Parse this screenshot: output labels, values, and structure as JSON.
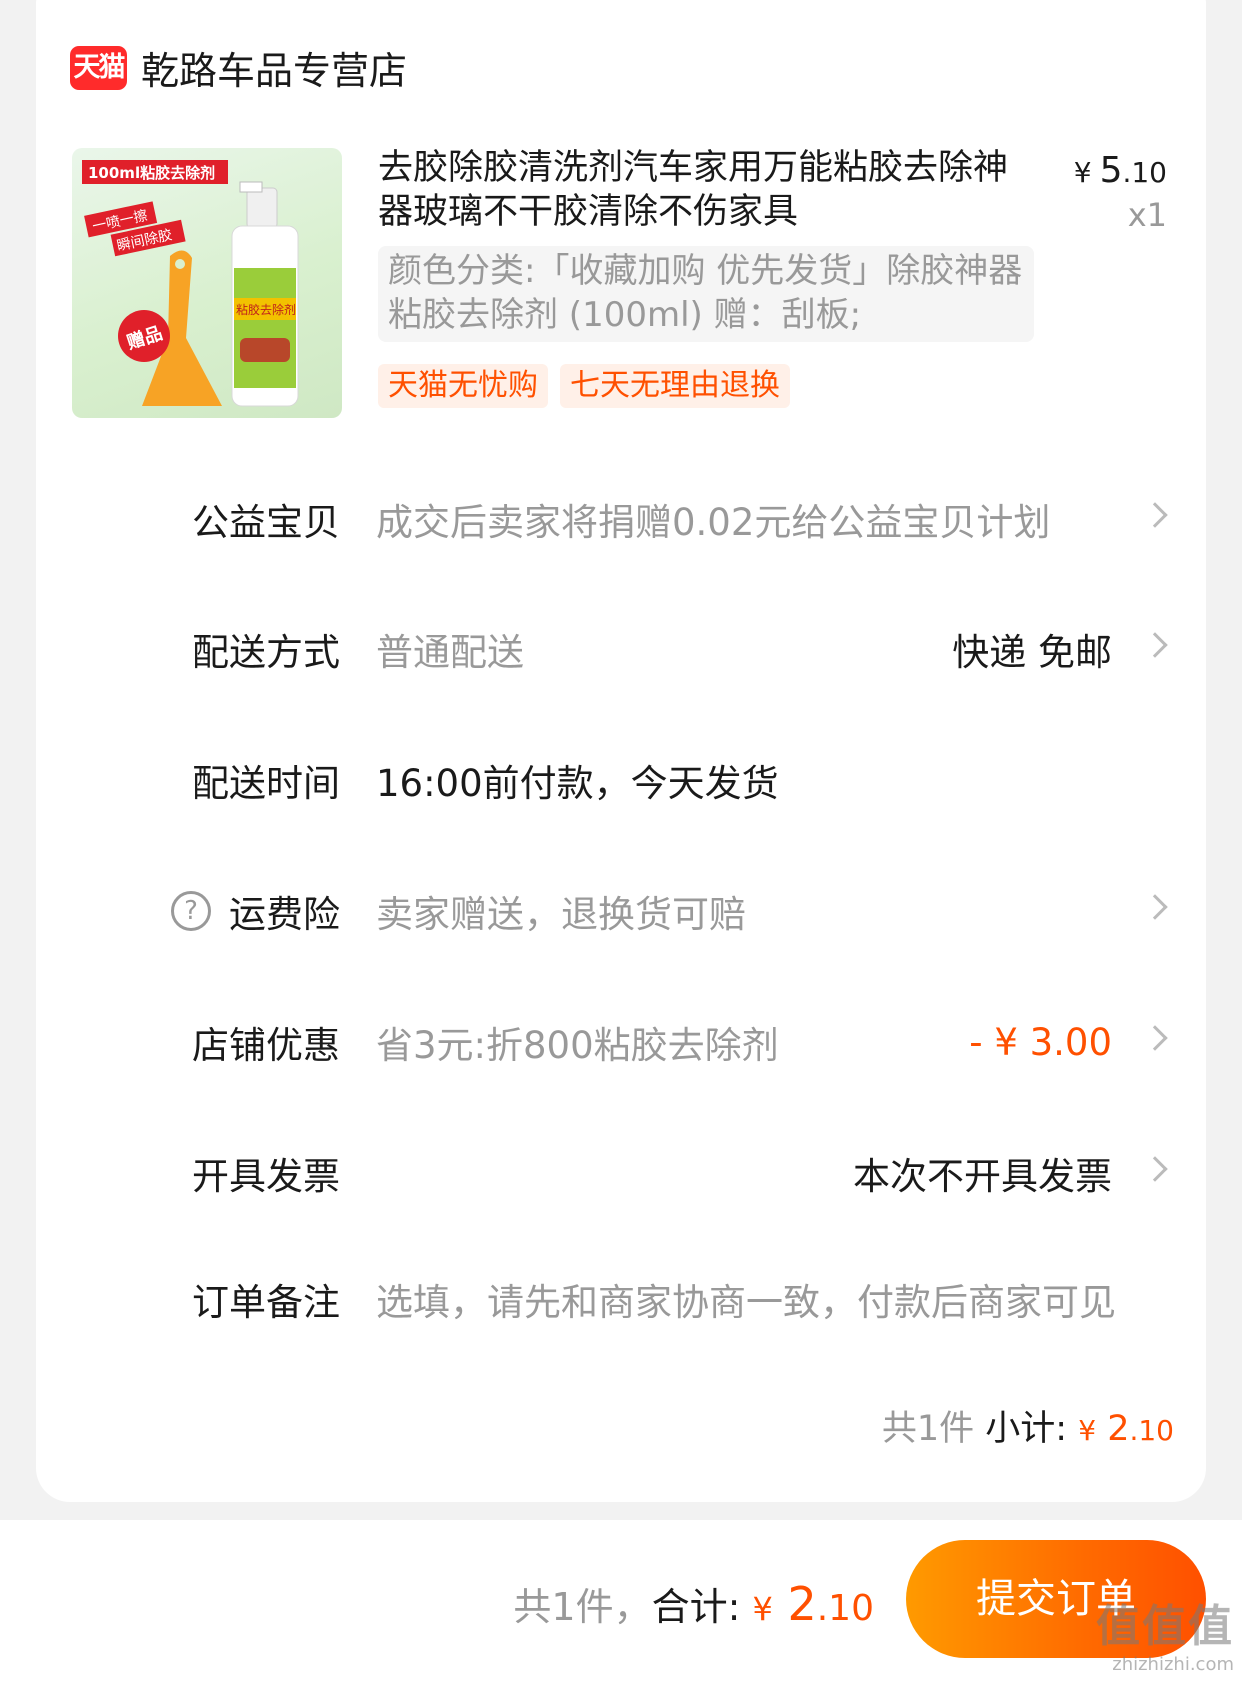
{
  "store": {
    "badge": "天猫",
    "name": "乾路车品专营店"
  },
  "product": {
    "title": "去胶除胶清洗剂汽车家用万能粘胶去除神器玻璃不干胶清除不伤家具",
    "price_currency": "¥",
    "price_int": "5",
    "price_dec": ".10",
    "qty": "x1",
    "spec": "颜色分类:「收藏加购 优先发货」除胶神器 粘胶去除剂 (100ml) 赠：刮板;",
    "tags": [
      "天猫无忧购",
      "七天无理由退换"
    ],
    "image": {
      "banner": "100ml粘胶去除剂",
      "slogan1": "一喷一擦",
      "slogan2": "瞬间除胶",
      "gift": "赠品",
      "bottle_label": "粘胶去除剂"
    }
  },
  "rows": {
    "charity": {
      "label": "公益宝贝",
      "value": "成交后卖家将捐赠0.02元给公益宝贝计划"
    },
    "delivery": {
      "label": "配送方式",
      "value": "普通配送",
      "right": "快递 免邮"
    },
    "delivery_time": {
      "label": "配送时间",
      "value": "16:00前付款，今天发货"
    },
    "insurance": {
      "label": "运费险",
      "value": "卖家赠送，退换货可赔",
      "icon": "question-circle-icon"
    },
    "discount": {
      "label": "店铺优惠",
      "value": "省3元:折800粘胶去除剂",
      "right": "- ¥ 3.00"
    },
    "invoice": {
      "label": "开具发票",
      "right": "本次不开具发票"
    },
    "note": {
      "label": "订单备注",
      "placeholder": "选填，请先和商家协商一致，付款后商家可见"
    }
  },
  "subtotal": {
    "count": "共1件",
    "label": "小计:",
    "currency": "¥",
    "int": " 2",
    "dec": ".10"
  },
  "bottom": {
    "count": "共1件，",
    "label": "合计:",
    "currency": "¥",
    "int": " 2",
    "dec": ".10",
    "submit": "提交订单"
  },
  "watermark": {
    "big": "值值值",
    "small": "zhizhizhi.com"
  },
  "colors": {
    "accent": "#ff5000",
    "tmall": "#ff2b2b"
  }
}
